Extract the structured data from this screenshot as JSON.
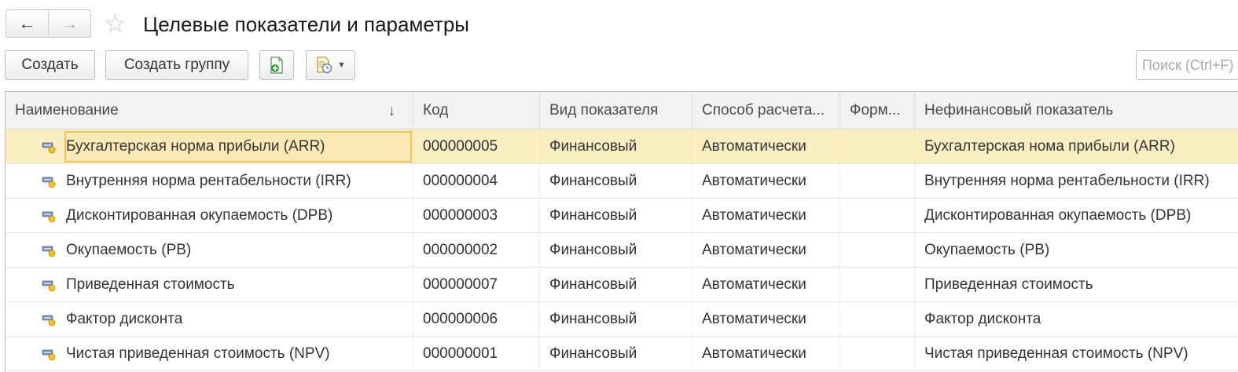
{
  "window": {
    "title": "Целевые показатели и параметры",
    "back_icon": "arrow-left-icon",
    "forward_icon": "arrow-right-icon",
    "favorite_icon": "star-icon"
  },
  "toolbar": {
    "create_label": "Создать",
    "create_group_label": "Создать группу",
    "copy_icon": "document-add-icon",
    "report_icon": "document-clock-icon",
    "search_placeholder": "Поиск (Ctrl+F)"
  },
  "table": {
    "columns": [
      "Наименование",
      "Код",
      "Вид показателя",
      "Способ расчета...",
      "Форм...",
      "Нефинансовый показатель"
    ],
    "sort_icon": "sort-down-arrow-icon",
    "rows": [
      {
        "name": "Бухгалтерская норма прибыли (ARR)",
        "code": "000000005",
        "kind": "Финансовый",
        "method": "Автоматически",
        "formula": "",
        "nonfin": "Бухгалтерская нома прибыли (ARR)"
      },
      {
        "name": "Внутренняя норма рентабельности (IRR)",
        "code": "000000004",
        "kind": "Финансовый",
        "method": "Автоматически",
        "formula": "",
        "nonfin": "Внутренняя норма рентабельности (IRR)"
      },
      {
        "name": "Дисконтированная окупаемость (DPB)",
        "code": "000000003",
        "kind": "Финансовый",
        "method": "Автоматически",
        "formula": "",
        "nonfin": "Дисконтированная окупаемость (DPB)"
      },
      {
        "name": "Окупаемость (PB)",
        "code": "000000002",
        "kind": "Финансовый",
        "method": "Автоматически",
        "formula": "",
        "nonfin": "Окупаемость (PB)"
      },
      {
        "name": "Приведенная стоимость",
        "code": "000000007",
        "kind": "Финансовый",
        "method": "Автоматически",
        "formula": "",
        "nonfin": "Приведенная стоимость"
      },
      {
        "name": "Фактор дисконта",
        "code": "000000006",
        "kind": "Финансовый",
        "method": "Автоматически",
        "formula": "",
        "nonfin": "Фактор дисконта"
      },
      {
        "name": "Чистая приведенная стоимость (NPV)",
        "code": "000000001",
        "kind": "Финансовый",
        "method": "Автоматически",
        "formula": "",
        "nonfin": "Чистая приведенная стоимость (NPV)"
      }
    ],
    "selected_row": 0
  },
  "colors": {
    "selected_row": "#fbeec2",
    "focus_border": "#f0c556",
    "header_bg": "#f2f2f2"
  }
}
